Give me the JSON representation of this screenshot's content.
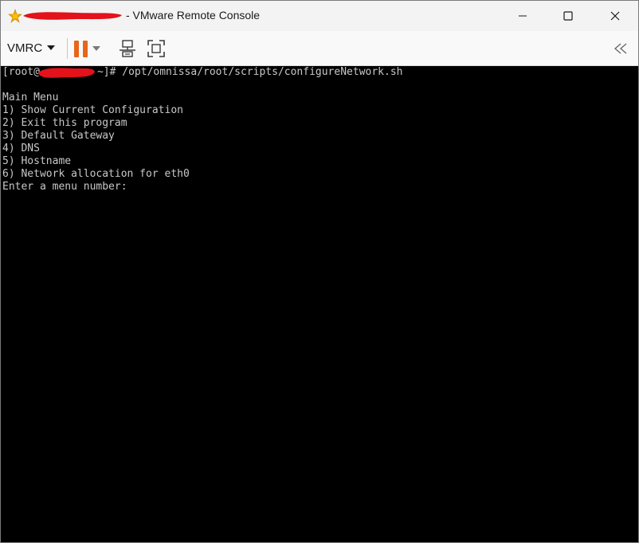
{
  "window": {
    "title": "- VMware Remote Console",
    "redacted_title_prefix": true
  },
  "title_buttons": {
    "minimize_icon": "minimize-icon",
    "maximize_icon": "maximize-icon",
    "close_icon": "close-icon"
  },
  "toolbar": {
    "vmrc_label": "VMRC",
    "icons": [
      "pause-icon",
      "dropdown-icon",
      "send-keys-icon",
      "fullscreen-icon",
      "collapse-toolbar-icon"
    ],
    "pause_color": "#e8651b"
  },
  "console": {
    "prompt_prefix": "[root@",
    "prompt_suffix": "~]# /opt/omnissa/root/scripts/configureNetwork.sh",
    "lines": [
      "Main Menu",
      "1) Show Current Configuration",
      "2) Exit this program",
      "3) Default Gateway",
      "4) DNS",
      "5) Hostname",
      "6) Network allocation for eth0",
      "Enter a menu number:"
    ],
    "text_color": "#c8c8c8",
    "background": "#000000",
    "redaction_color": "#e3121b"
  }
}
